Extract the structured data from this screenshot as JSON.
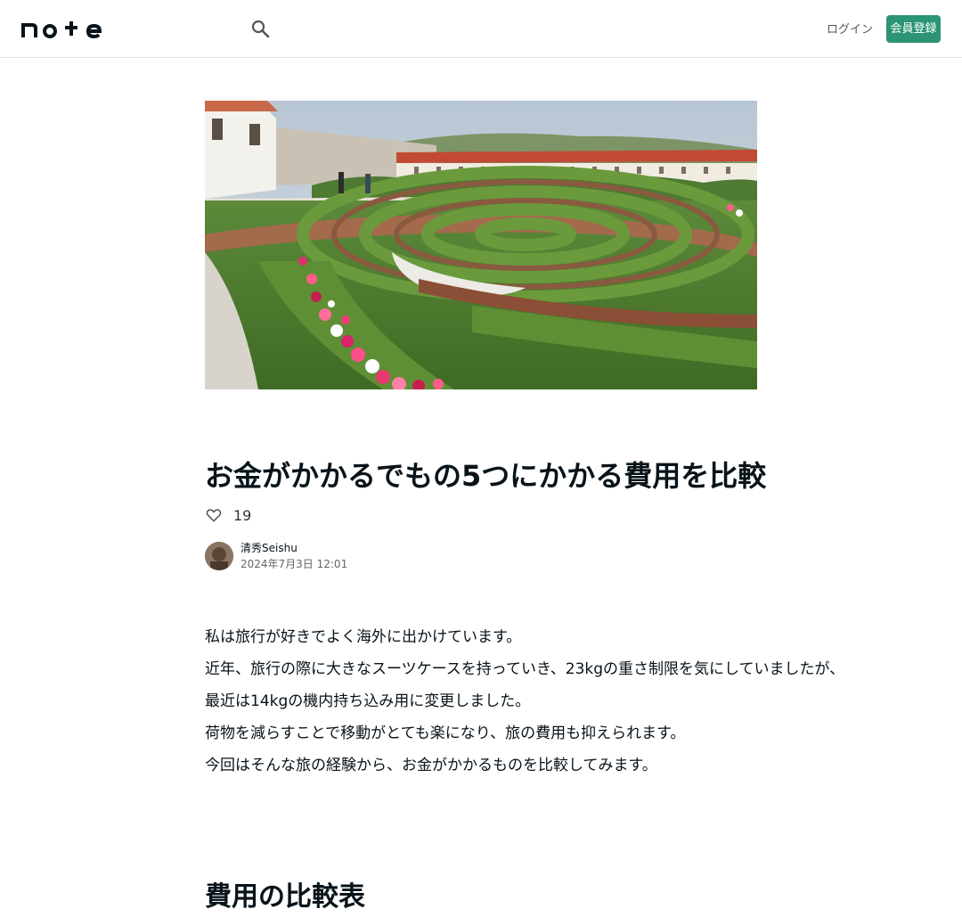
{
  "header": {
    "logo_text": "note",
    "login_label": "ログイン",
    "signup_label": "会員登録"
  },
  "article": {
    "title": "お金がかかるでもの5つにかかる費用を比較",
    "like_count": "19",
    "author_name": "清秀Seishu",
    "date": "2024年7月3日 12:01",
    "paragraphs": [
      "私は旅行が好きでよく海外に出かけています。",
      "近年、旅行の際に大きなスーツケースを持っていき、23kgの重さ制限を気にしていましたが、",
      "最近は14kgの機内持ち込み用に変更しました。",
      "荷物を減らすことで移動がとても楽になり、旅の費用も抑えられます。",
      "今回はそんな旅の経験から、お金がかかるものを比較してみます。"
    ],
    "section_heading": "費用の比較表"
  },
  "colors": {
    "accent": "#2b9474",
    "text": "#08131a"
  },
  "icons": {
    "search": "search-icon",
    "like": "heart-icon"
  }
}
